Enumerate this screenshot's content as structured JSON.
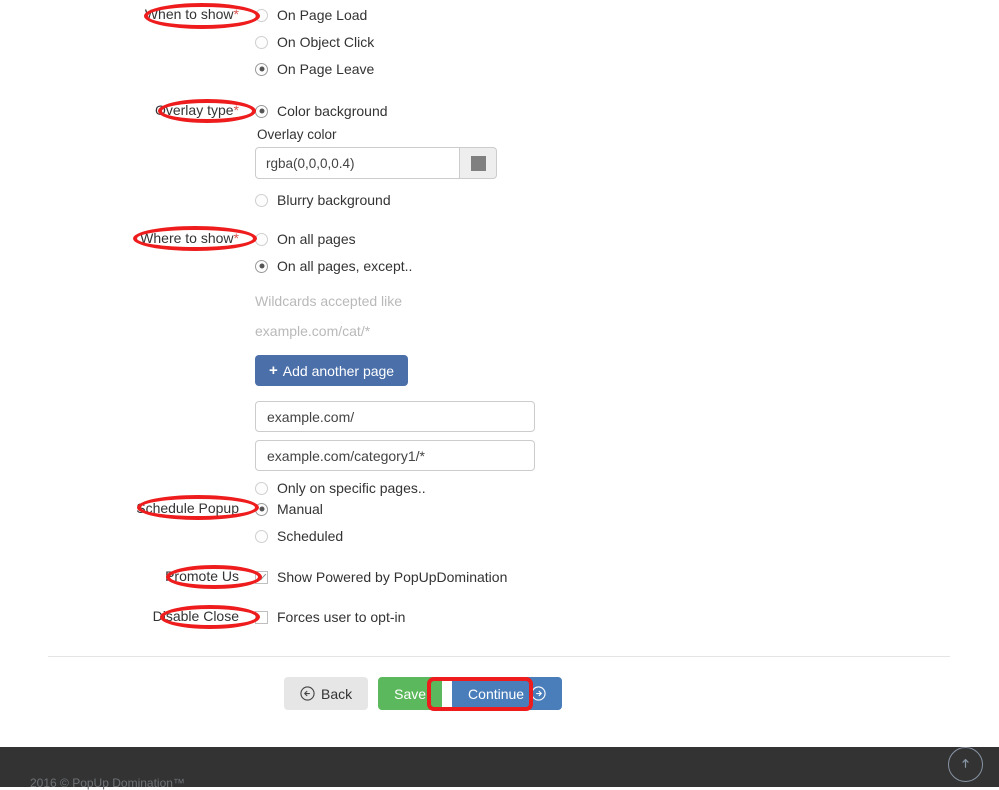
{
  "form": {
    "rows": [
      {
        "key": "when_to_show",
        "label": "When to show",
        "required_mark": "*",
        "options": [
          {
            "label": "On Page Load",
            "checked": false
          },
          {
            "label": "On Object Click",
            "checked": false
          },
          {
            "label": "On Page Leave",
            "checked": true
          }
        ]
      },
      {
        "key": "overlay_type",
        "label": "Overlay type",
        "required_mark": "*",
        "options": [
          {
            "label": "Color background",
            "checked": true
          },
          {
            "label": "Blurry background",
            "checked": false
          }
        ],
        "overlay_color_label": "Overlay color",
        "overlay_color_value": "rgba(0,0,0,0.4)",
        "overlay_color_swatch": "#808080"
      },
      {
        "key": "where_to_show",
        "label": "Where to show",
        "required_mark": "*",
        "options": [
          {
            "label": "On all pages",
            "checked": false
          },
          {
            "label": "On all pages, except..",
            "checked": true
          },
          {
            "label": "Only on specific pages..",
            "checked": false
          }
        ],
        "helper_line1": "Wildcards accepted like",
        "helper_line2": "example.com/cat/*",
        "add_page_button": "Add another page",
        "add_page_icon": "plus-icon",
        "pages": [
          "example.com/",
          "example.com/category1/*"
        ]
      },
      {
        "key": "schedule_popup",
        "label": "Schedule Popup",
        "required_mark": "",
        "options": [
          {
            "label": "Manual",
            "checked": true
          },
          {
            "label": "Scheduled",
            "checked": false
          }
        ]
      },
      {
        "key": "promote_us",
        "label": "Promote Us",
        "required_mark": "",
        "checkboxes": [
          {
            "label": "Show Powered by PopUpDomination",
            "checked": true
          }
        ]
      },
      {
        "key": "disable_close",
        "label": "Disable Close",
        "required_mark": "",
        "checkboxes": [
          {
            "label": "Forces user to opt-in",
            "checked": false
          }
        ]
      }
    ]
  },
  "actions": {
    "back_label": "Back",
    "back_icon": "arrow-left-circle-icon",
    "save_label": "Save",
    "continue_label": "Continue",
    "continue_icon": "arrow-right-circle-icon"
  },
  "footer": {
    "copyright": "2016 © PopUp Domination™",
    "to_top_icon": "arrow-up-circle-icon"
  },
  "annotations": {
    "highlight_color": "#ee1c1c",
    "items": [
      "when-to-show-label",
      "overlay-type-label",
      "where-to-show-label",
      "schedule-popup-label",
      "promote-us-label",
      "disable-close-label",
      "continue-button"
    ]
  },
  "colors": {
    "add_page_button": "#4a6fa9",
    "save_button": "#5cb85c",
    "continue_button": "#4a7ebb",
    "back_button": "#e6e6e6",
    "footer_bg": "#333333"
  }
}
